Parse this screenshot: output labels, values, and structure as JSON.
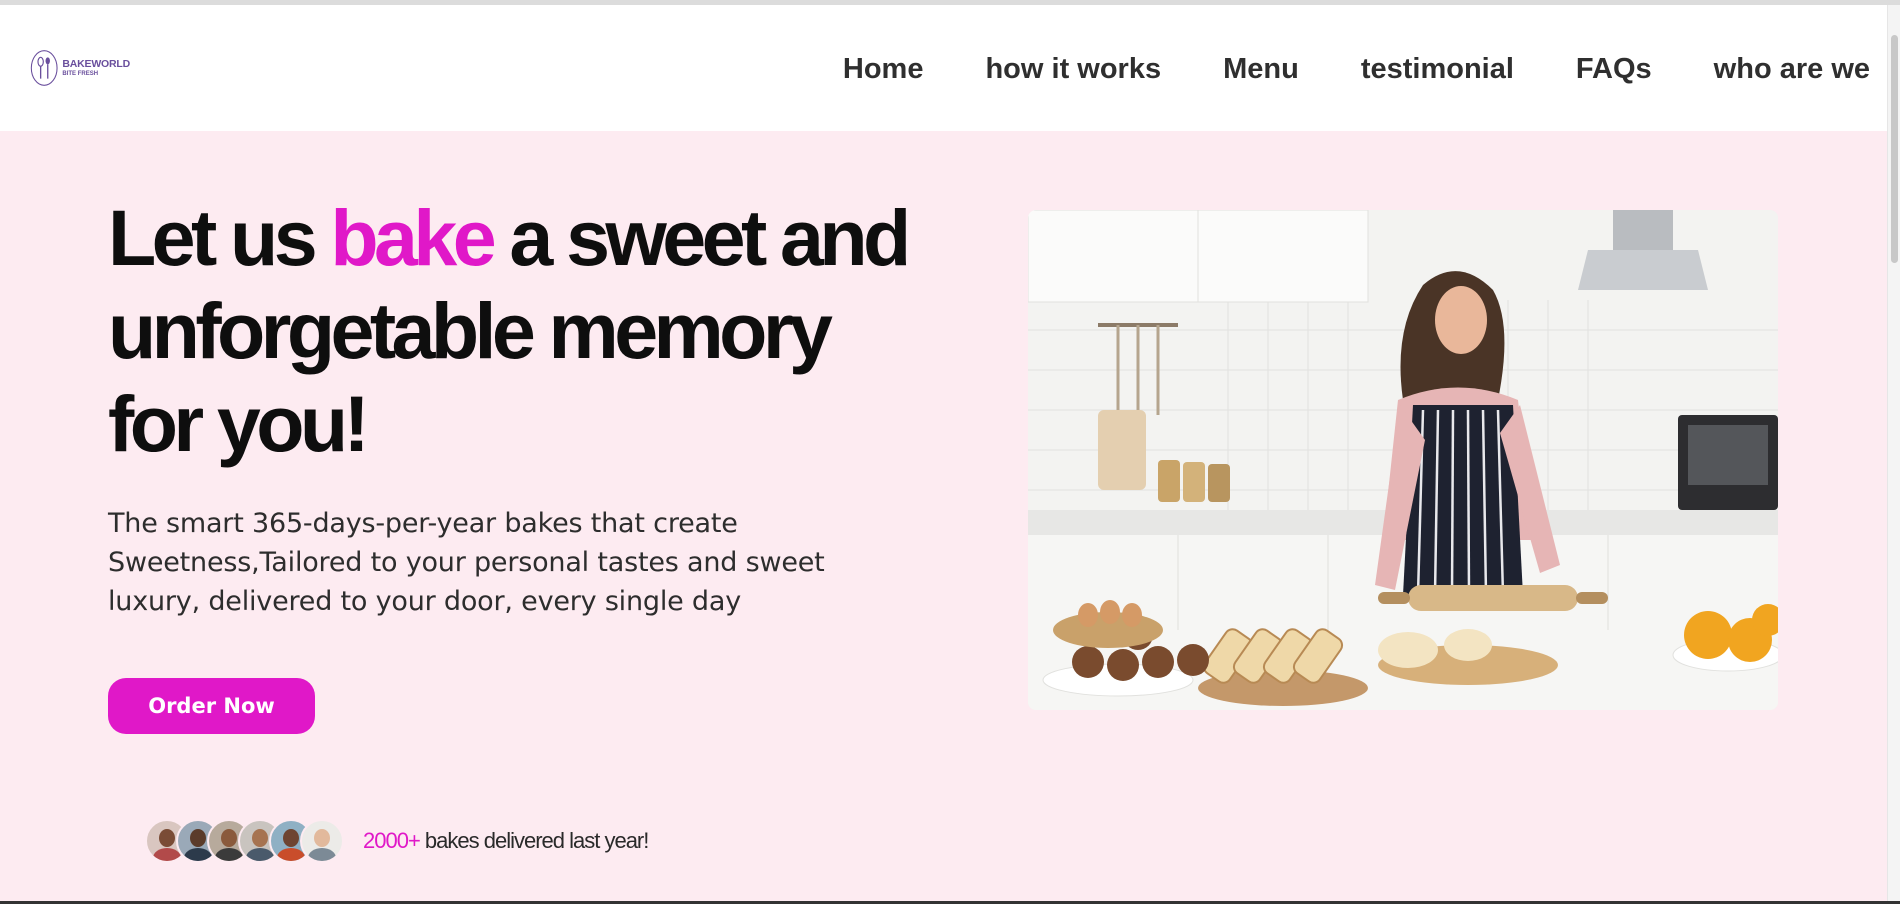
{
  "brand": {
    "name": "BAKEWORLD",
    "tagline": "BITE FRESH"
  },
  "nav": {
    "items": [
      {
        "label": "Home"
      },
      {
        "label": "how it works"
      },
      {
        "label": "Menu"
      },
      {
        "label": "testimonial"
      },
      {
        "label": "FAQs"
      },
      {
        "label": "who are we"
      }
    ]
  },
  "hero": {
    "headline_part1": "Let us ",
    "headline_accent": "bake",
    "headline_part2": " a sweet and unforgetable memory for you!",
    "subtitle": "The smart 365-days-per-year bakes that create Sweetness,Tailored to your personal tastes and sweet luxury, delivered to your door, every single day",
    "cta_label": "Order Now",
    "social_proof_count": "2000+",
    "social_proof_text": " bakes delivered last year!"
  },
  "colors": {
    "accent": "#e018c8",
    "hero_bg": "#fdebf1",
    "logo": "#6a4f9d"
  },
  "icons": {
    "logo": "whisk-spoon-logo-icon"
  }
}
